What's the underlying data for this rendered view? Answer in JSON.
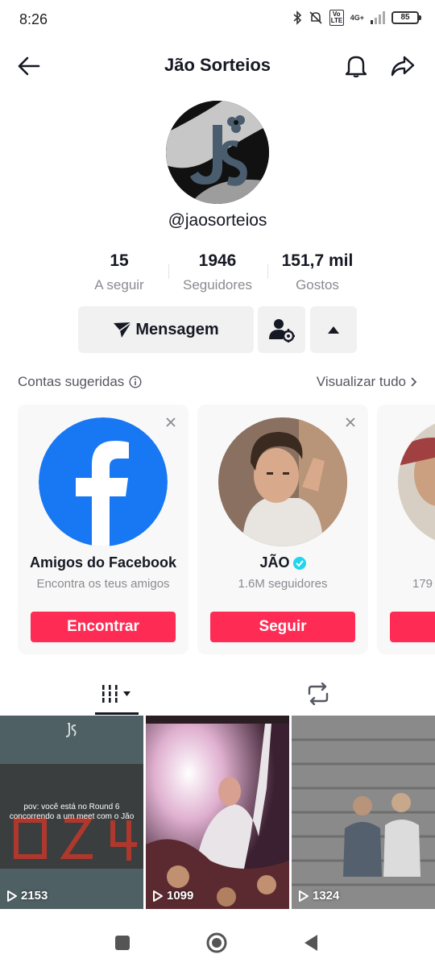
{
  "status_bar": {
    "time": "8:26",
    "network": "4G+",
    "lte": "Vo LTE",
    "battery": "85"
  },
  "header": {
    "title": "Jão Sorteios",
    "icons": [
      "back-arrow-icon",
      "bell-icon",
      "share-icon"
    ]
  },
  "profile": {
    "username": "@jaosorteios",
    "stats": [
      {
        "value": "15",
        "label": "A seguir"
      },
      {
        "value": "1946",
        "label": "Seguidores"
      },
      {
        "value": "151,7 mil",
        "label": "Gostos"
      }
    ],
    "message_label": "Mensagem"
  },
  "suggested": {
    "title": "Contas sugeridas",
    "view_all": "Visualizar tudo",
    "cards": [
      {
        "name": "Amigos do Facebook",
        "subtitle": "Encontra os teus amigos",
        "button": "Encontrar"
      },
      {
        "name": "JÃO",
        "subtitle": "1.6M seguidores",
        "button": "Seguir",
        "verified": true
      },
      {
        "name": "",
        "subtitle": "179",
        "button": ""
      }
    ]
  },
  "videos": [
    {
      "views": "2153",
      "caption": "pov: você está no Round 6 concorrendo a um meet com o Jão"
    },
    {
      "views": "1099",
      "caption": ""
    },
    {
      "views": "1324",
      "caption": ""
    }
  ],
  "colors": {
    "accent": "#fe2c55",
    "facebook": "#1877f2",
    "verified": "#20d5ec"
  }
}
